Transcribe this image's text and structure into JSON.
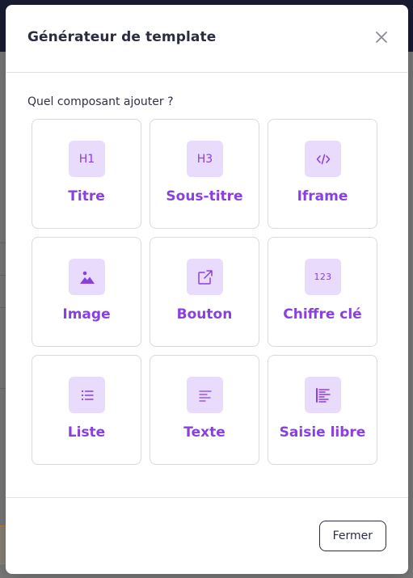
{
  "modal": {
    "title": "Générateur de template",
    "prompt": "Quel composant ajouter ?",
    "footer": {
      "close_label": "Fermer"
    }
  },
  "components": [
    {
      "label": "Titre",
      "icon": "heading-1-icon",
      "glyph": "H1"
    },
    {
      "label": "Sous-titre",
      "icon": "heading-3-icon",
      "glyph": "H3"
    },
    {
      "label": "Iframe",
      "icon": "code-icon",
      "glyph": ""
    },
    {
      "label": "Image",
      "icon": "image-icon",
      "glyph": ""
    },
    {
      "label": "Bouton",
      "icon": "external-link-icon",
      "glyph": ""
    },
    {
      "label": "Chiffre clé",
      "icon": "numbers-icon",
      "glyph": "123"
    },
    {
      "label": "Liste",
      "icon": "list-icon",
      "glyph": ""
    },
    {
      "label": "Texte",
      "icon": "text-align-icon",
      "glyph": ""
    },
    {
      "label": "Saisie libre",
      "icon": "free-text-icon",
      "glyph": ""
    }
  ],
  "colors": {
    "accent": "#8a3fe0",
    "tile_background": "#e9dbfb",
    "title_text": "#2a2c40",
    "border": "#d9d9de"
  }
}
